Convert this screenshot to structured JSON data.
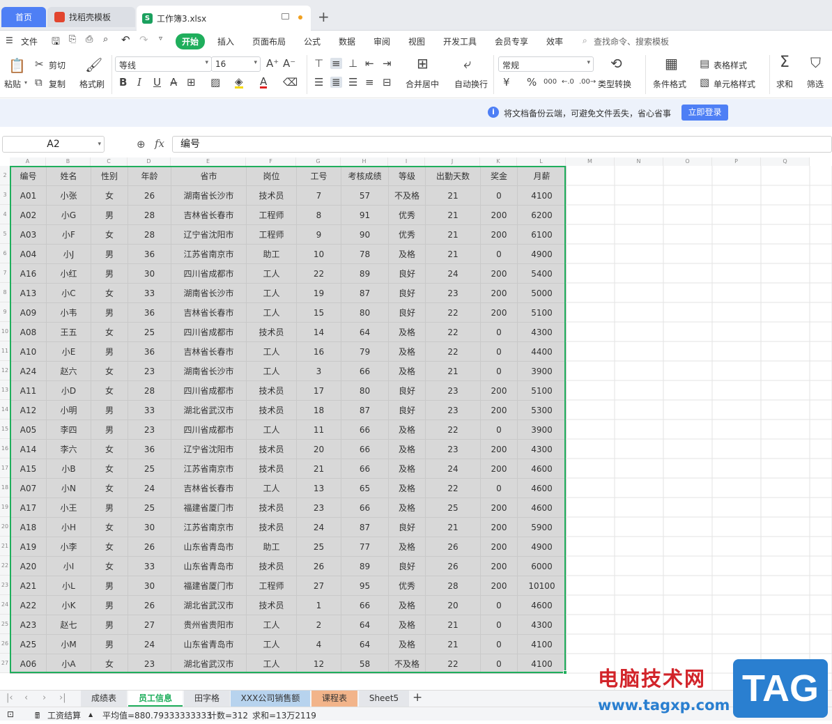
{
  "tabs": {
    "home": "首页",
    "template": "找稻壳模板",
    "doc": "工作簿3.xlsx",
    "doc_icon": "S",
    "plus": "+"
  },
  "menu": {
    "file": "文件",
    "items": [
      "开始",
      "插入",
      "页面布局",
      "公式",
      "数据",
      "审阅",
      "视图",
      "开发工具",
      "会员专享",
      "效率"
    ],
    "search": "查找命令、搜索模板"
  },
  "ribbon": {
    "paste": "粘贴",
    "cut": "剪切",
    "copy": "复制",
    "format_painter": "格式刷",
    "font": "等线",
    "size": "16",
    "merge": "合并居中",
    "wrap": "自动换行",
    "number_format": "常规",
    "convert": "类型转换",
    "cond_format": "条件格式",
    "table_style": "表格样式",
    "cell_style": "单元格样式",
    "sum": "求和",
    "filter": "筛选"
  },
  "notice": {
    "text": "将文档备份云端，可避免文件丢失，省心省事",
    "button": "立即登录",
    "icon": "i"
  },
  "formula_bar": {
    "name_box": "A2",
    "fx": "fx",
    "content": "编号"
  },
  "columns": [
    "A",
    "B",
    "C",
    "D",
    "E",
    "F",
    "G",
    "H",
    "I",
    "J",
    "K",
    "L",
    "M",
    "N",
    "O",
    "P",
    "Q"
  ],
  "row_numbers": [
    "2",
    "3",
    "4",
    "5",
    "6",
    "7",
    "8",
    "9",
    "10",
    "11",
    "12",
    "13",
    "14",
    "15",
    "16",
    "17",
    "18",
    "19",
    "20",
    "21",
    "22",
    "23",
    "24",
    "25",
    "26",
    "27"
  ],
  "headers": [
    "编号",
    "姓名",
    "性别",
    "年龄",
    "省市",
    "岗位",
    "工号",
    "考核成绩",
    "等级",
    "出勤天数",
    "奖金",
    "月薪"
  ],
  "rows": [
    [
      "A01",
      "小张",
      "女",
      "26",
      "湖南省长沙市",
      "技术员",
      "7",
      "57",
      "不及格",
      "21",
      "0",
      "4100"
    ],
    [
      "A02",
      "小G",
      "男",
      "28",
      "吉林省长春市",
      "工程师",
      "8",
      "91",
      "优秀",
      "21",
      "200",
      "6200"
    ],
    [
      "A03",
      "小F",
      "女",
      "28",
      "辽宁省沈阳市",
      "工程师",
      "9",
      "90",
      "优秀",
      "21",
      "200",
      "6100"
    ],
    [
      "A04",
      "小J",
      "男",
      "36",
      "江苏省南京市",
      "助工",
      "10",
      "78",
      "及格",
      "21",
      "0",
      "4900"
    ],
    [
      "A16",
      "小红",
      "男",
      "30",
      "四川省成都市",
      "工人",
      "22",
      "89",
      "良好",
      "24",
      "200",
      "5400"
    ],
    [
      "A13",
      "小C",
      "女",
      "33",
      "湖南省长沙市",
      "工人",
      "19",
      "87",
      "良好",
      "23",
      "200",
      "5000"
    ],
    [
      "A09",
      "小韦",
      "男",
      "36",
      "吉林省长春市",
      "工人",
      "15",
      "80",
      "良好",
      "22",
      "200",
      "5100"
    ],
    [
      "A08",
      "王五",
      "女",
      "25",
      "四川省成都市",
      "技术员",
      "14",
      "64",
      "及格",
      "22",
      "0",
      "4300"
    ],
    [
      "A10",
      "小E",
      "男",
      "36",
      "吉林省长春市",
      "工人",
      "16",
      "79",
      "及格",
      "22",
      "0",
      "4400"
    ],
    [
      "A24",
      "赵六",
      "女",
      "23",
      "湖南省长沙市",
      "工人",
      "3",
      "66",
      "及格",
      "21",
      "0",
      "3900"
    ],
    [
      "A11",
      "小D",
      "女",
      "28",
      "四川省成都市",
      "技术员",
      "17",
      "80",
      "良好",
      "23",
      "200",
      "5100"
    ],
    [
      "A12",
      "小明",
      "男",
      "33",
      "湖北省武汉市",
      "技术员",
      "18",
      "87",
      "良好",
      "23",
      "200",
      "5300"
    ],
    [
      "A05",
      "李四",
      "男",
      "23",
      "四川省成都市",
      "工人",
      "11",
      "66",
      "及格",
      "22",
      "0",
      "3900"
    ],
    [
      "A14",
      "李六",
      "女",
      "36",
      "辽宁省沈阳市",
      "技术员",
      "20",
      "66",
      "及格",
      "23",
      "200",
      "4300"
    ],
    [
      "A15",
      "小B",
      "女",
      "25",
      "江苏省南京市",
      "技术员",
      "21",
      "66",
      "及格",
      "24",
      "200",
      "4600"
    ],
    [
      "A07",
      "小N",
      "女",
      "24",
      "吉林省长春市",
      "工人",
      "13",
      "65",
      "及格",
      "22",
      "0",
      "4600"
    ],
    [
      "A17",
      "小王",
      "男",
      "25",
      "福建省厦门市",
      "技术员",
      "23",
      "66",
      "及格",
      "25",
      "200",
      "4600"
    ],
    [
      "A18",
      "小H",
      "女",
      "30",
      "江苏省南京市",
      "技术员",
      "24",
      "87",
      "良好",
      "21",
      "200",
      "5900"
    ],
    [
      "A19",
      "小李",
      "女",
      "26",
      "山东省青岛市",
      "助工",
      "25",
      "77",
      "及格",
      "26",
      "200",
      "4900"
    ],
    [
      "A20",
      "小I",
      "女",
      "33",
      "山东省青岛市",
      "技术员",
      "26",
      "89",
      "良好",
      "26",
      "200",
      "6000"
    ],
    [
      "A21",
      "小L",
      "男",
      "30",
      "福建省厦门市",
      "工程师",
      "27",
      "95",
      "优秀",
      "28",
      "200",
      "10100"
    ],
    [
      "A22",
      "小K",
      "男",
      "26",
      "湖北省武汉市",
      "技术员",
      "1",
      "66",
      "及格",
      "20",
      "0",
      "4600"
    ],
    [
      "A23",
      "赵七",
      "男",
      "27",
      "贵州省贵阳市",
      "工人",
      "2",
      "64",
      "及格",
      "21",
      "0",
      "4300"
    ],
    [
      "A25",
      "小M",
      "男",
      "24",
      "山东省青岛市",
      "工人",
      "4",
      "64",
      "及格",
      "21",
      "0",
      "4100"
    ],
    [
      "A06",
      "小A",
      "女",
      "23",
      "湖北省武汉市",
      "工人",
      "12",
      "58",
      "不及格",
      "22",
      "0",
      "4100"
    ]
  ],
  "sheet_tabs": [
    "成绩表",
    "员工信息",
    "田字格",
    "XXX公司销售额",
    "课程表",
    "Sheet5"
  ],
  "sheet_tab_colors": {
    "active": "#1fae5c",
    "blue": "#b7d3ee",
    "orange": "#f2b48a"
  },
  "status": {
    "calc": "工资结算",
    "avg": "平均值=880.79333333333",
    "count": "计数=312",
    "sum": "求和=13万2119"
  },
  "watermark": {
    "title": "电脑技术网",
    "url": "www.tagxp.com",
    "tag": "TAG"
  }
}
